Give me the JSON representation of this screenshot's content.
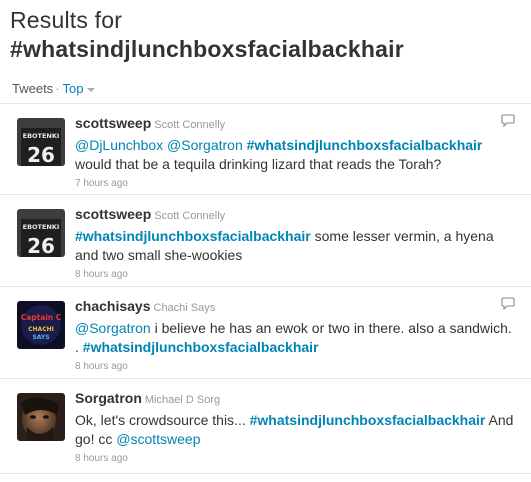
{
  "header": {
    "line1": "Results for",
    "line2": "#whatsindjlunchboxsfacialbackhair"
  },
  "tabs": {
    "tweets_label": "Tweets",
    "separator": "·",
    "top_label": "Top"
  },
  "tweets": [
    {
      "screen_name": "scottsweep",
      "full_name": "Scott Connelly",
      "text_parts": [
        {
          "t": "@DjLunchbox",
          "k": "mention"
        },
        {
          "t": " ",
          "k": "plain"
        },
        {
          "t": "@Sorgatron",
          "k": "mention"
        },
        {
          "t": " ",
          "k": "plain"
        },
        {
          "t": "#whatsindjlunchboxsfacialbackhair",
          "k": "hashtag"
        },
        {
          "t": " would that be a tequila drinking lizard that reads the Torah?",
          "k": "plain"
        }
      ],
      "time": "7 hours ago",
      "avatar_text": "EBOTENKI 26",
      "reply_icon": "reply-icon"
    },
    {
      "screen_name": "scottsweep",
      "full_name": "Scott Connelly",
      "text_parts": [
        {
          "t": "#whatsindjlunchboxsfacialbackhair",
          "k": "hashtag"
        },
        {
          "t": " some lesser vermin, a hyena and two small she-wookies",
          "k": "plain"
        }
      ],
      "time": "8 hours ago",
      "avatar_text": "EBOTENKI 26",
      "reply_icon": ""
    },
    {
      "screen_name": "chachisays",
      "full_name": "Chachi Says",
      "text_parts": [
        {
          "t": "@Sorgatron",
          "k": "mention"
        },
        {
          "t": " i believe he has an ewok or two in there. also a sandwich. . ",
          "k": "plain"
        },
        {
          "t": "#whatsindjlunchboxsfacialbackhair",
          "k": "hashtag"
        }
      ],
      "time": "8 hours ago",
      "avatar_text": "Captain C",
      "reply_icon": "reply-icon"
    },
    {
      "screen_name": "Sorgatron",
      "full_name": "Michael D Sorg",
      "text_parts": [
        {
          "t": "Ok, let's crowdsource this... ",
          "k": "plain"
        },
        {
          "t": "#whatsindjlunchboxsfacialbackhair",
          "k": "hashtag"
        },
        {
          "t": " And go! cc ",
          "k": "plain"
        },
        {
          "t": "@scottsweep",
          "k": "mention"
        }
      ],
      "time": "8 hours ago",
      "avatar_text": "",
      "reply_icon": ""
    }
  ]
}
